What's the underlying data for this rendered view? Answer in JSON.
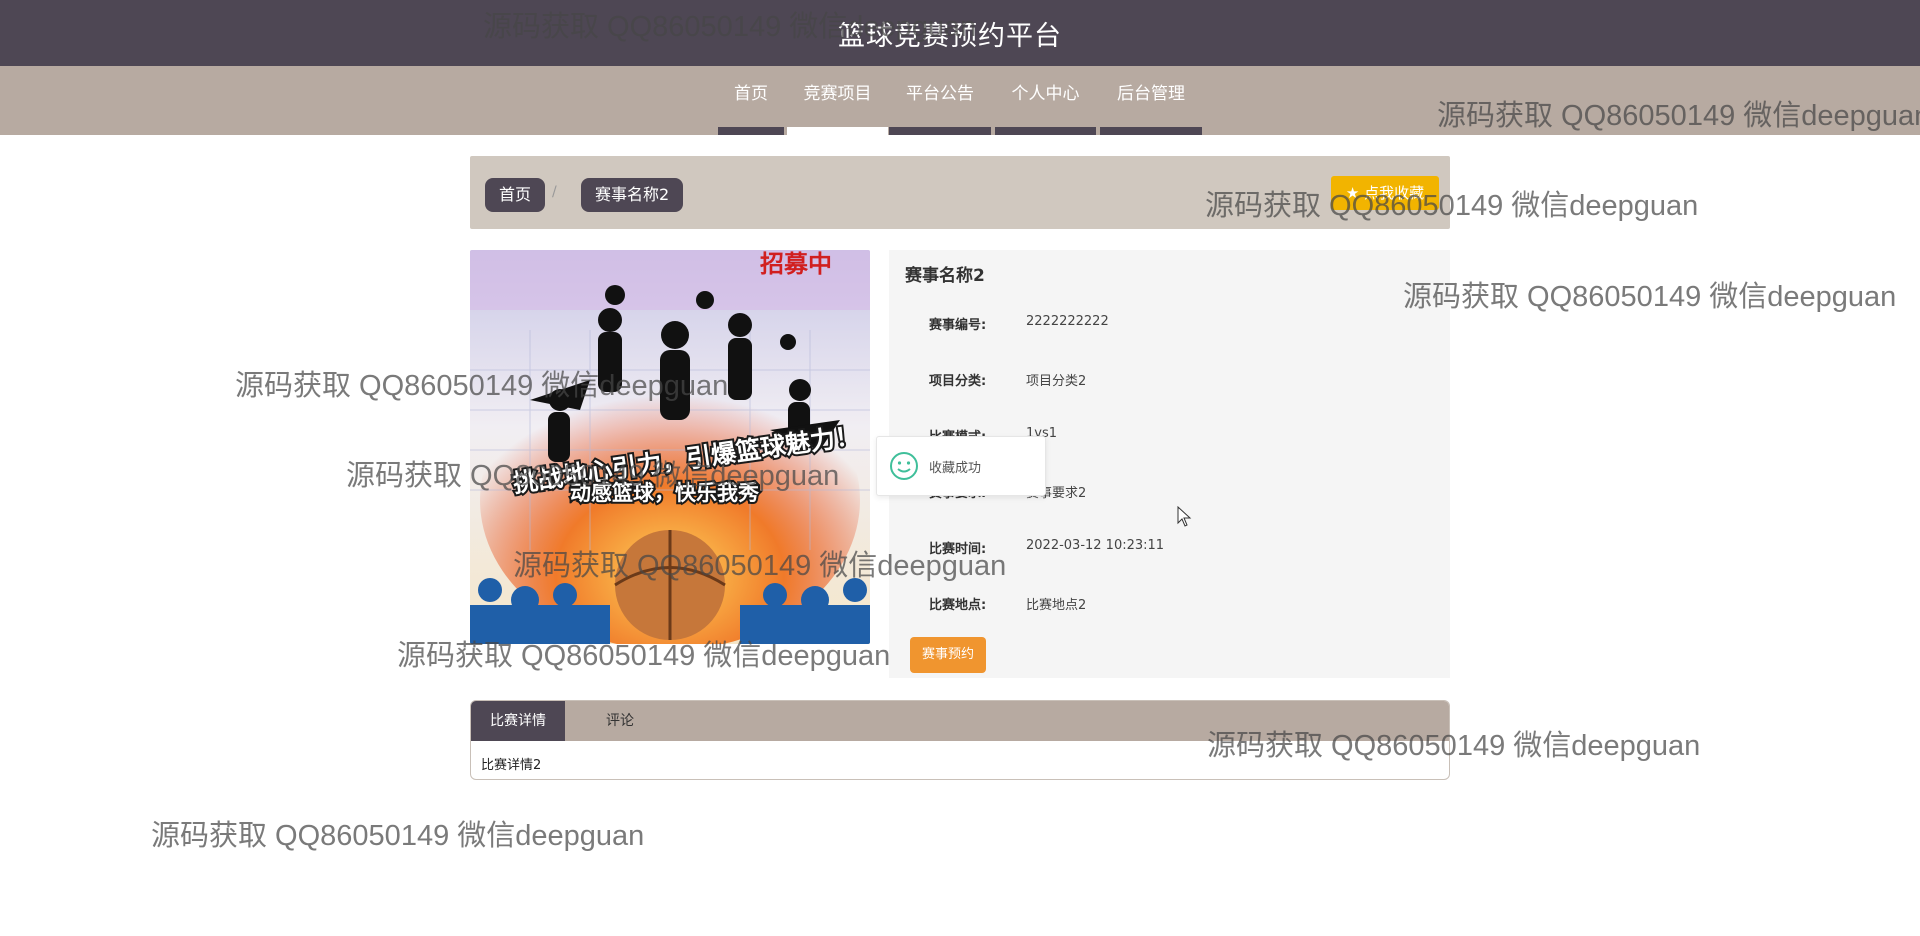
{
  "header": {
    "title": "篮球竞赛预约平台"
  },
  "nav": {
    "items": [
      {
        "label": "首页"
      },
      {
        "label": "竞赛项目"
      },
      {
        "label": "平台公告"
      },
      {
        "label": "个人中心"
      },
      {
        "label": "后台管理"
      }
    ],
    "active_index": 1
  },
  "breadcrumb": {
    "home": "首页",
    "separator": "/",
    "current": "赛事名称2",
    "favorite_button": "★ 点我收藏"
  },
  "poster": {
    "badge": "招募中",
    "slogan_line1": "挑战地心引力，引爆篮球魅力！",
    "slogan_line2": "动感篮球，快乐我秀"
  },
  "detail": {
    "title": "赛事名称2",
    "fields": [
      {
        "label": "赛事编号:",
        "value": "2222222222"
      },
      {
        "label": "项目分类:",
        "value": "项目分类2"
      },
      {
        "label": "比赛模式:",
        "value": "1vs1"
      },
      {
        "label": "赛事要求:",
        "value": "赛事要求2"
      },
      {
        "label": "比赛时间:",
        "value": "2022-03-12 10:23:11"
      },
      {
        "label": "比赛地点:",
        "value": "比赛地点2"
      }
    ],
    "book_button": "赛事预约"
  },
  "toast": {
    "text": "收藏成功"
  },
  "tabs": {
    "items": [
      {
        "label": "比赛详情"
      },
      {
        "label": "评论"
      }
    ],
    "content": "比赛详情2"
  },
  "watermark": {
    "text": "源码获取 QQ86050149 微信deepguan"
  },
  "colors": {
    "header_bg": "#4e4754",
    "nav_bg": "#b7aaa1",
    "favorite_button": "#f2b400",
    "book_button": "#f0952f",
    "toast_icon": "#3fbf9a"
  }
}
